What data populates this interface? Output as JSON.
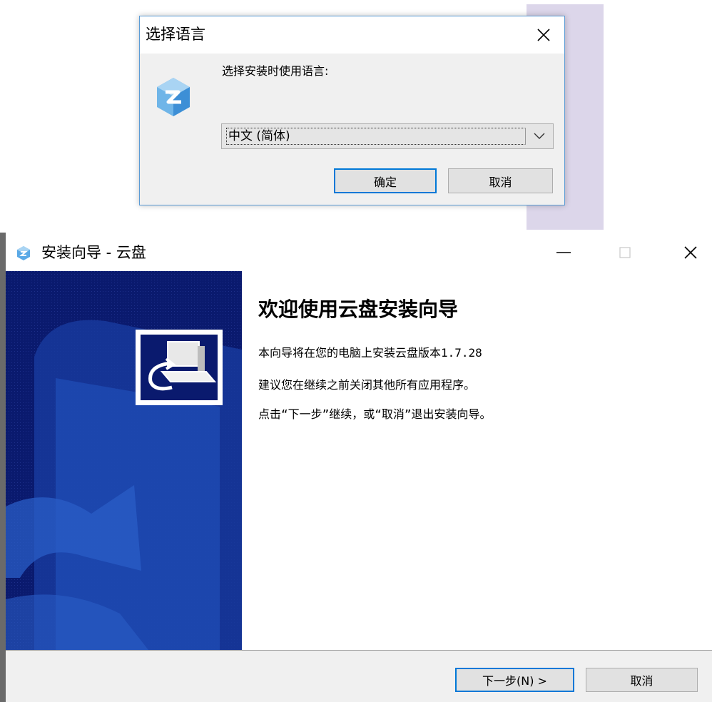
{
  "language_dialog": {
    "title": "选择语言",
    "prompt": "选择安装时使用语言:",
    "selected_language": "中文 (简体)",
    "ok_label": "确定",
    "cancel_label": "取消"
  },
  "wizard": {
    "title": "安装向导 - 云盘",
    "heading": "欢迎使用云盘安装向导",
    "lines": [
      "本向导将在您的电脑上安装云盘版本1.7.28",
      "建议您在继续之前关闭其他所有应用程序。",
      "点击“下一步”继续，或“取消”退出安装向导。"
    ],
    "next_label": "下一步(N) >",
    "cancel_label": "取消"
  },
  "icons": {
    "close": "close-icon",
    "minimize": "minimize-icon",
    "maximize": "maximize-icon",
    "dropdown": "chevron-down-icon",
    "app": "cloud-disk-app-icon",
    "install": "install-computer-icon"
  },
  "colors": {
    "banner": "#0a1a6e",
    "accent": "#0078d7",
    "dialog_bg": "#f0f0f0"
  }
}
